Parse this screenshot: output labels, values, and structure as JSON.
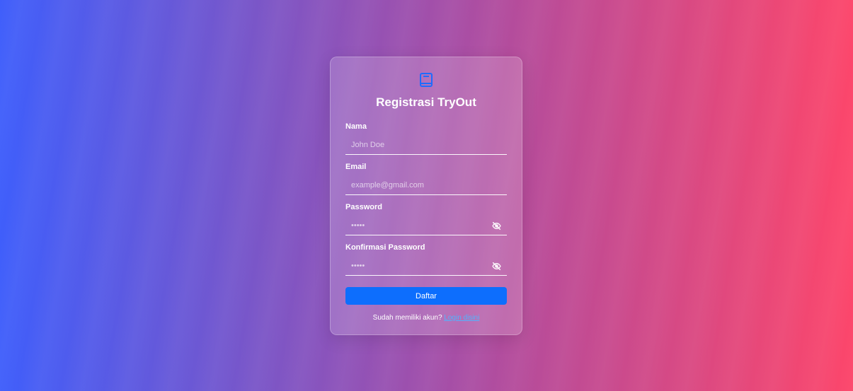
{
  "form": {
    "title": "Registrasi TryOut",
    "logo_icon": "book-icon",
    "fields": [
      {
        "label": "Nama",
        "placeholder": "John Doe",
        "type": "text"
      },
      {
        "label": "Email",
        "placeholder": "example@gmail.com",
        "type": "email"
      },
      {
        "label": "Password",
        "placeholder": "•••••",
        "type": "password",
        "icon": "eye-slash-icon"
      },
      {
        "label": "Konfirmasi Password",
        "placeholder": "•••••",
        "type": "password",
        "icon": "eye-slash-icon"
      }
    ],
    "submit_label": "Daftar",
    "footer_text": "Sudah memiliki akun?",
    "footer_link": "Login disini"
  },
  "colors": {
    "gradient_start": "#3f5efb",
    "gradient_end": "#fc466b",
    "button": "#0d6efd",
    "link": "#4fb4ff"
  }
}
